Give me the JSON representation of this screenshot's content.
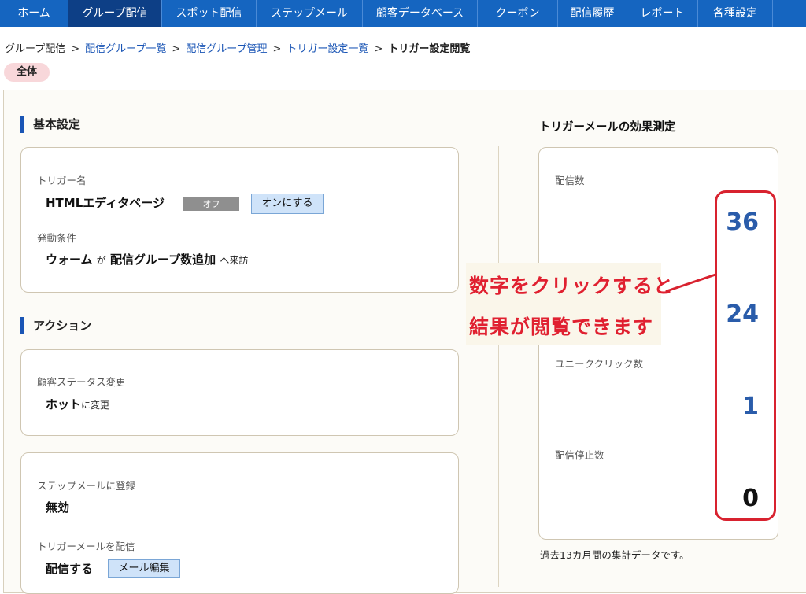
{
  "nav": {
    "items": [
      "ホーム",
      "グループ配信",
      "スポット配信",
      "ステップメール",
      "顧客データベース",
      "クーポン",
      "配信履歴",
      "レポート",
      "各種設定"
    ],
    "active": "グループ配信"
  },
  "breadcrumb": {
    "items": [
      "グループ配信",
      "配信グループ一覧",
      "配信グループ管理",
      "トリガー設定一覧"
    ],
    "current": "トリガー設定閲覧"
  },
  "scope_pill": "全体",
  "basic": {
    "title": "基本設定",
    "trigger_name_label": "トリガー名",
    "trigger_name": "HTMLエディタページ",
    "status": "オフ",
    "turn_on_button": "オンにする",
    "condition_label": "発動条件",
    "condition_subject": "ウォーム",
    "condition_particle": "が",
    "condition_event": "配信グループ数追加",
    "condition_suffix": "へ来訪"
  },
  "action": {
    "title": "アクション",
    "status_change_label": "顧客ステータス変更",
    "status_value": "ホット",
    "status_suffix": "に変更",
    "step_label": "ステップメールに登録",
    "step_value": "無効",
    "send_label": "トリガーメールを配信",
    "send_value": "配信する",
    "edit_button": "メール編集"
  },
  "metrics": {
    "title": "トリガーメールの効果測定",
    "sent_label": "配信数",
    "sent": "36",
    "second": "24",
    "unique_click_label": "ユニーククリック数",
    "unique_click": "1",
    "stopped_label": "配信停止数",
    "stopped": "0",
    "footnote": "過去13カ月間の集計データです。"
  },
  "callout": {
    "line1": "数字をクリックすると",
    "line2": "結果が閲覧できます"
  },
  "colors": {
    "nav_bg": "#1565c0",
    "nav_active": "#0d3f86",
    "metric_blue": "#2a5caa",
    "callout_red": "#e02030"
  }
}
